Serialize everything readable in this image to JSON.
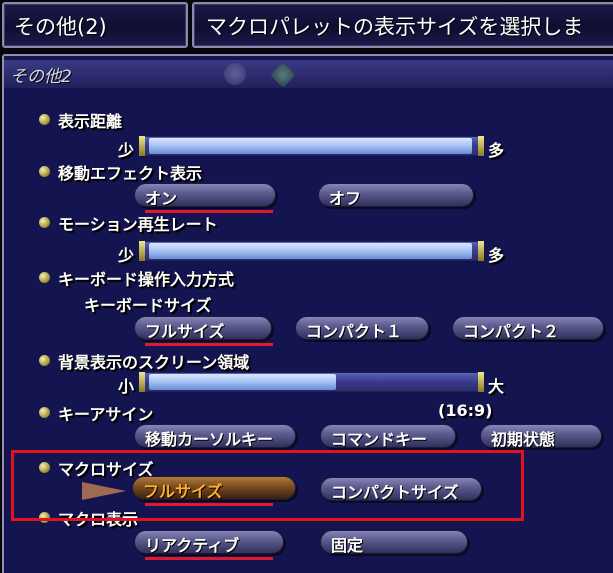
{
  "header": {
    "title": "その他(2)",
    "description": "マクロパレットの表示サイズを選択しま"
  },
  "section": {
    "title": "その他2"
  },
  "settings": {
    "view_distance": {
      "label": "表示距離",
      "min_label": "少",
      "max_label": "多",
      "level": 1.0
    },
    "move_effect": {
      "label": "移動エフェクト表示",
      "on": "オン",
      "off": "オフ",
      "selected": "オン"
    },
    "motion_rate": {
      "label": "モーション再生レート",
      "min_label": "少",
      "max_label": "多",
      "level": 1.0
    },
    "keyboard_input": {
      "label": "キーボード操作入力方式",
      "sub_label": "キーボードサイズ",
      "options": [
        "フルサイズ",
        "コンパクト１",
        "コンパクト２"
      ],
      "selected": "フルサイズ"
    },
    "screen_area": {
      "label": "背景表示のスクリーン領域",
      "min_label": "小",
      "max_label": "大",
      "ratio": "(16:9)",
      "level": 0.58
    },
    "key_assign": {
      "label": "キーアサイン",
      "options": [
        "移動カーソルキー",
        "コマンドキー",
        "初期状態"
      ]
    },
    "macro_size": {
      "label": "マクロサイズ",
      "options": [
        "フルサイズ",
        "コンパクトサイズ"
      ],
      "selected": "フルサイズ"
    },
    "macro_display": {
      "label": "マクロ表示",
      "options": [
        "リアクティブ",
        "固定"
      ],
      "selected": "リアクティブ"
    }
  },
  "colors": {
    "selection_underline": "#e01830",
    "highlight_box": "#e1131e",
    "active_option_text": "#ffae2e"
  }
}
